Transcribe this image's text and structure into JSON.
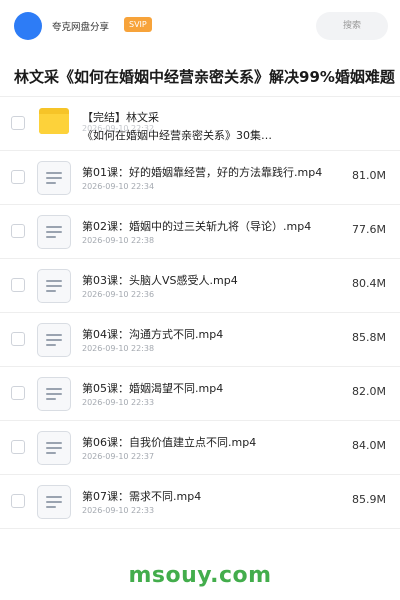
{
  "header": {
    "share_name": "夸克网盘分享",
    "badge": "SVIP",
    "search_placeholder": "搜索",
    "avatar_color": "#2d7cf6",
    "badge_color": "#f7a33a"
  },
  "title": "林文采《如何在婚姻中经营亲密关系》解决99%婚姻难题",
  "folder": {
    "name_line1": "【完结】林文采",
    "name_line2": "《如何在婚姻中经营亲密关系》30集…",
    "date": "2026-09-10 22:32",
    "icon": "folder-icon"
  },
  "files": [
    {
      "name": "第01课：好的婚姻靠经营，好的方法靠践行.mp4",
      "date": "2026-09-10 22:34",
      "size": "81.0M",
      "icon": "document-icon"
    },
    {
      "name": "第02课：婚姻中的过三关斩九将（导论）.mp4",
      "date": "2026-09-10 22:38",
      "size": "77.6M",
      "icon": "document-icon"
    },
    {
      "name": "第03课：头脑人VS感受人.mp4",
      "date": "2026-09-10 22:36",
      "size": "80.4M",
      "icon": "document-icon"
    },
    {
      "name": "第04课：沟通方式不同.mp4",
      "date": "2026-09-10 22:38",
      "size": "85.8M",
      "icon": "document-icon"
    },
    {
      "name": "第05课：婚姻渴望不同.mp4",
      "date": "2026-09-10 22:33",
      "size": "82.0M",
      "icon": "document-icon"
    },
    {
      "name": "第06课：自我价值建立点不同.mp4",
      "date": "2026-09-10 22:37",
      "size": "84.0M",
      "icon": "document-icon"
    },
    {
      "name": "第07课：需求不同.mp4",
      "date": "2026-09-10 22:33",
      "size": "85.9M",
      "icon": "document-icon"
    }
  ],
  "watermark": "msouy.com",
  "watermark_color": "#43ad4c"
}
